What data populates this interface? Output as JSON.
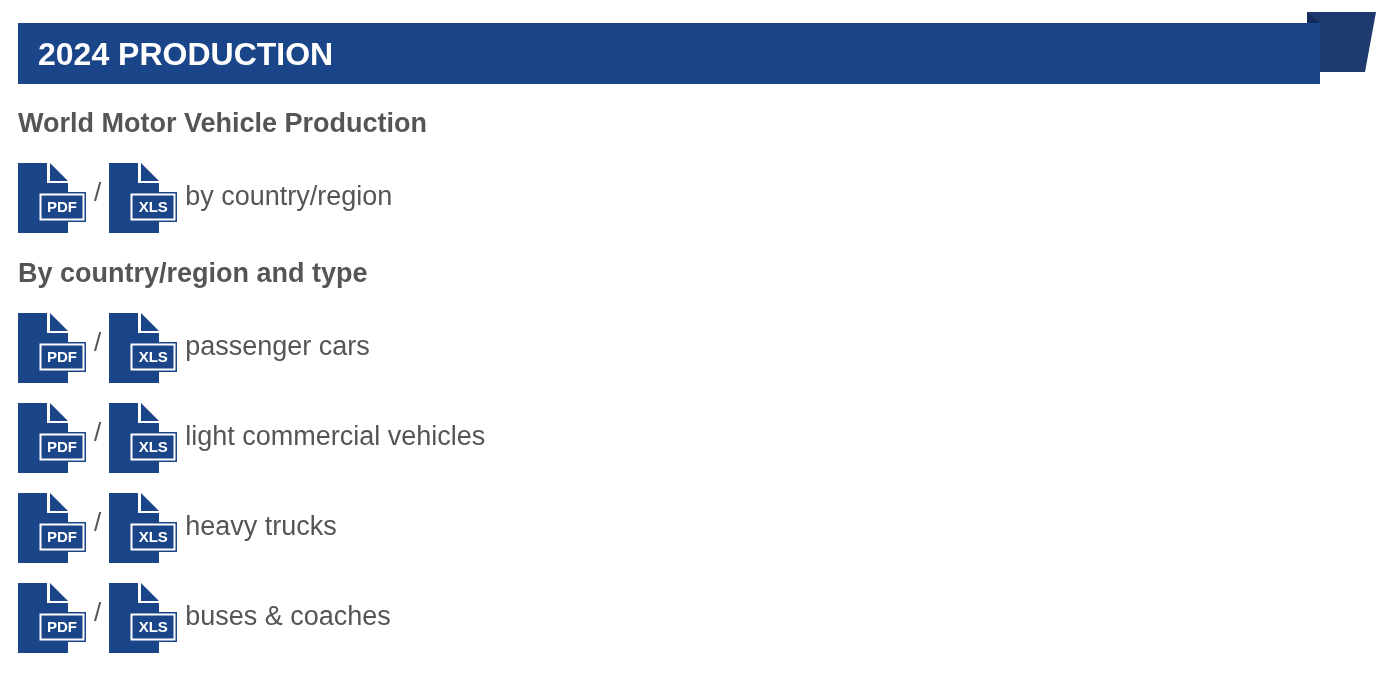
{
  "header": {
    "title": "2024 PRODUCTION"
  },
  "sections": [
    {
      "heading": "World Motor Vehicle Production",
      "rows": [
        {
          "links": [
            {
              "label": "PDF"
            },
            {
              "label": "XLS"
            }
          ],
          "separator": "/",
          "text": "by country/region"
        }
      ]
    },
    {
      "heading": "By country/region and type",
      "rows": [
        {
          "links": [
            {
              "label": "PDF"
            },
            {
              "label": "XLS"
            }
          ],
          "separator": "/",
          "text": "passenger cars"
        },
        {
          "links": [
            {
              "label": "PDF"
            },
            {
              "label": "XLS"
            }
          ],
          "separator": "/",
          "text": "light commercial vehicles"
        },
        {
          "links": [
            {
              "label": "PDF"
            },
            {
              "label": "XLS"
            }
          ],
          "separator": "/",
          "text": "heavy trucks"
        },
        {
          "links": [
            {
              "label": "PDF"
            },
            {
              "label": "XLS"
            }
          ],
          "separator": "/",
          "text": "buses & coaches"
        }
      ]
    }
  ]
}
